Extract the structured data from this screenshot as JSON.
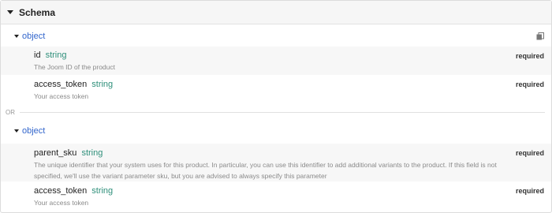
{
  "schema": {
    "title": "Schema",
    "or_label": "OR",
    "required_label": "required",
    "alternatives": [
      {
        "label": "object",
        "properties": [
          {
            "name": "id",
            "type": "string",
            "description": "The Joom ID of the product",
            "required": true
          },
          {
            "name": "access_token",
            "type": "string",
            "description": "Your access token",
            "required": true
          }
        ]
      },
      {
        "label": "object",
        "properties": [
          {
            "name": "parent_sku",
            "type": "string",
            "description": "The unique identifier that your system uses for this product. In particular, you can use this identifier to add additional variants to the product. If this field is not specified, we'll use the variant parameter sku, but you are advised to always specify this parameter",
            "required": true
          },
          {
            "name": "access_token",
            "type": "string",
            "description": "Your access token",
            "required": true
          }
        ]
      }
    ]
  },
  "icons": {
    "collapse": "caret-down-icon",
    "copy": "copy-icon"
  },
  "colors": {
    "type": "#2e8f7a",
    "object_link": "#3366cc",
    "header_bg": "#f6f6f6",
    "row_shade": "#f7f7f7"
  }
}
